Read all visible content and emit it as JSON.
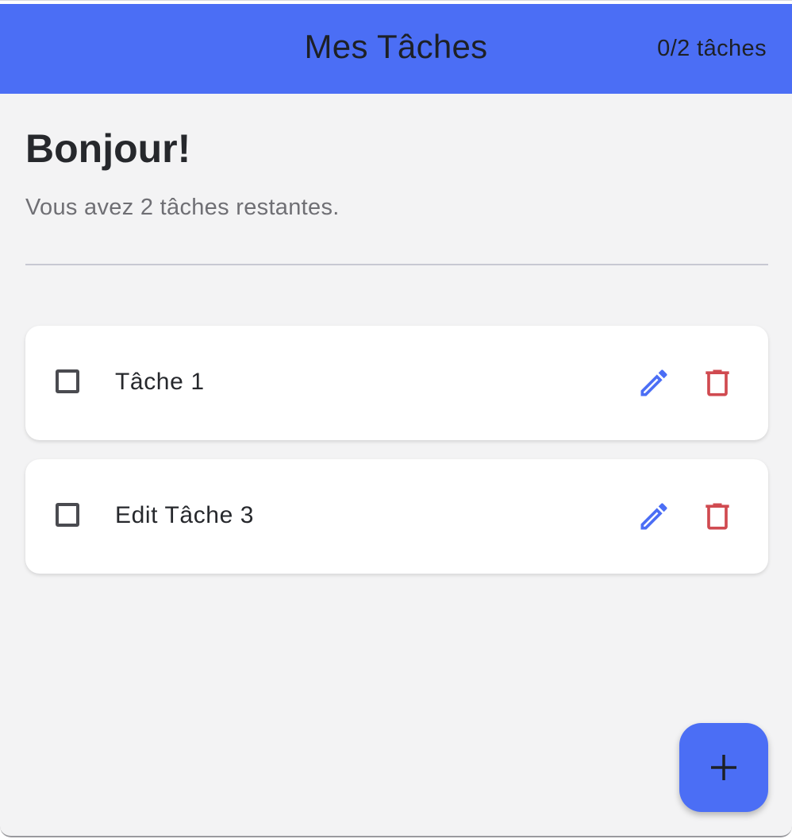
{
  "appbar": {
    "title": "Mes Tâches",
    "counter": "0/2 tâches"
  },
  "header": {
    "greeting": "Bonjour!",
    "subtitle": "Vous avez 2 tâches restantes."
  },
  "tasks": [
    {
      "label": "Tâche 1",
      "done": false
    },
    {
      "label": "Edit Tâche 3",
      "done": false
    }
  ],
  "icons": {
    "edit": "pencil-icon",
    "delete": "trash-icon",
    "add": "plus-icon"
  },
  "colors": {
    "primary": "#4b6ef5",
    "edit_icon": "#4b6ef5",
    "delete_icon": "#d04a50",
    "background": "#f3f3f4"
  }
}
